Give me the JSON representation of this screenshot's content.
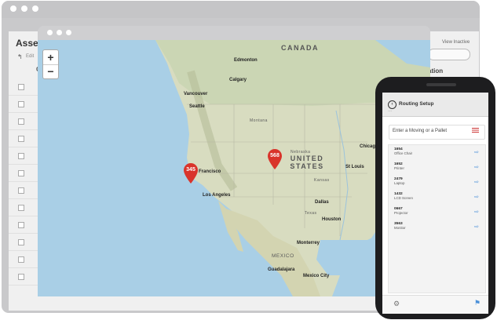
{
  "back_window": {
    "title": "Asset",
    "subtitle": "Edit",
    "header_right": [
      "t",
      "View Inactive"
    ],
    "column": "C",
    "side_label": "ation"
  },
  "map_window": {
    "zoom_in": "+",
    "zoom_out": "−",
    "labels": {
      "canada": "CANADA",
      "united_states": "UNITED STATES",
      "mexico": "MEXICO",
      "edmonton": "Edmonton",
      "calgary": "Calgary",
      "vancouver": "Vancouver",
      "seattle": "Seattle",
      "san_francisco": "Francisco",
      "los_angeles": "Los Angeles",
      "dallas": "Dallas",
      "houston": "Houston",
      "chicago": "Chicago",
      "st_louis": "St Louis",
      "monterrey": "Monterrey",
      "guadalajara": "Guadalajara",
      "mexico_city": "Mexico City",
      "nebraska": "Nebraska",
      "kansas": "Kansas",
      "texas": "Texas",
      "montana": "Montana"
    },
    "pins": [
      {
        "count": "345",
        "color": "#d9342b"
      },
      {
        "count": "568",
        "color": "#d9342b"
      }
    ]
  },
  "phone": {
    "title": "Routing Setup",
    "input_placeholder": "Enter a Moving or a Pallet",
    "items": [
      {
        "num": "1654",
        "desc": "Office Chair"
      },
      {
        "num": "1652",
        "desc": "Printer"
      },
      {
        "num": "2479",
        "desc": "Laptop"
      },
      {
        "num": "1432",
        "desc": "LCD Screen"
      },
      {
        "num": "0667",
        "desc": "Projector"
      },
      {
        "num": "3563",
        "desc": "Monitor"
      }
    ],
    "accent": "#4a90d9"
  }
}
